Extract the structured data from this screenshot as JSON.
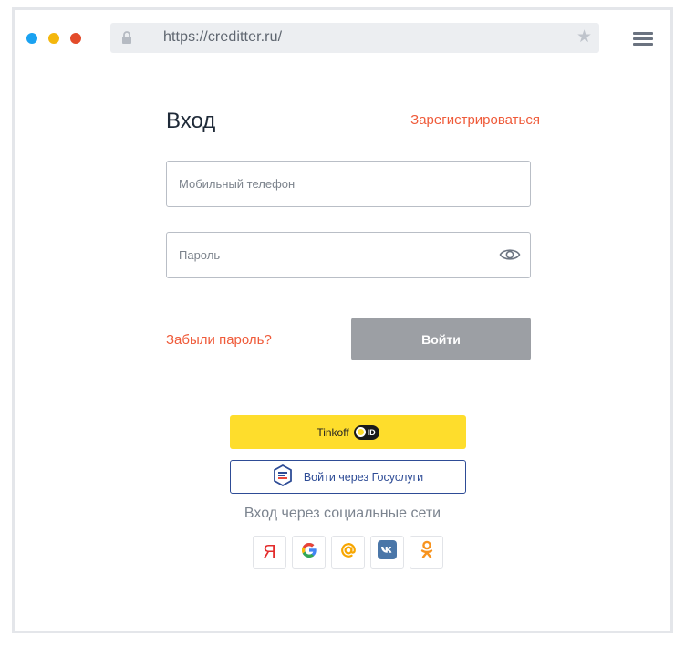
{
  "browser": {
    "url": "https://creditter.ru/",
    "icons": [
      "lock-icon",
      "star-icon",
      "hamburger-menu-icon"
    ],
    "window_dots": [
      "#1aa2f1",
      "#f4b70d",
      "#e34b2a"
    ]
  },
  "login": {
    "title": "Вход",
    "register_link": "Зарегистрироваться",
    "phone_placeholder": "Мобильный телефон",
    "password_placeholder": "Пароль",
    "forgot_link": "Забыли пароль?",
    "submit_label": "Войти"
  },
  "providers": {
    "tinkoff_label": "Tinkoff",
    "tinkoff_badge": "ID",
    "gosuslugi_label": "Войти через Госуслуги"
  },
  "social": {
    "caption": "Вход через социальные сети",
    "yandex_glyph": "Я",
    "items": [
      "yandex-icon",
      "google-icon",
      "mailru-icon",
      "vk-icon",
      "odnoklassniki-icon"
    ]
  },
  "colors": {
    "accent": "#ef5b3a",
    "button_disabled": "#9c9fa4",
    "tinkoff_yellow": "#fedd2c",
    "gosuslugi_blue": "#2e4c96"
  }
}
